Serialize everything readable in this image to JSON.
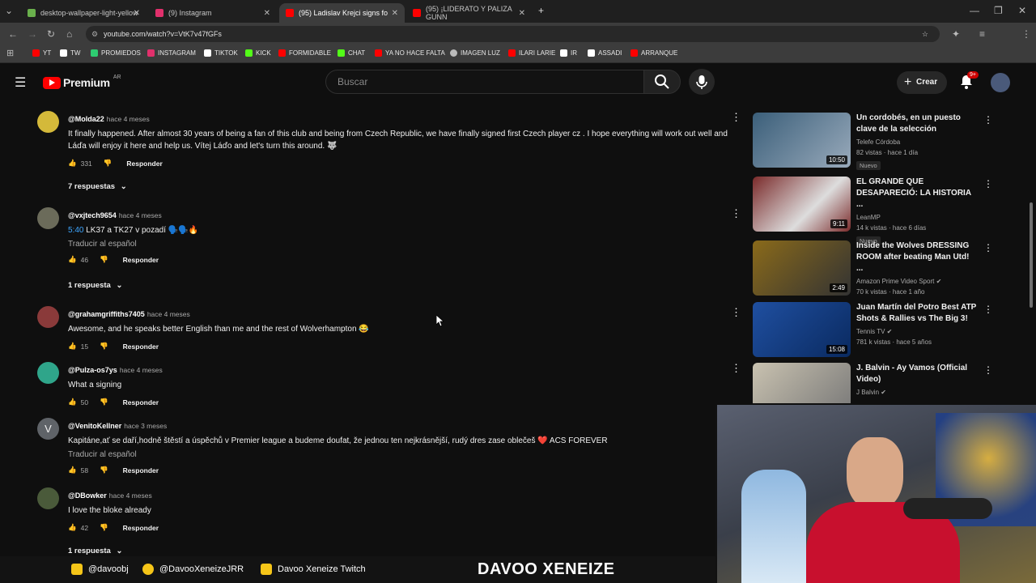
{
  "browser": {
    "tabs": [
      {
        "label": "desktop-wallpaper-light-yellow",
        "color": "#6ab04c"
      },
      {
        "label": "(9) Instagram",
        "color": "#e1306c"
      },
      {
        "label": "(95) Ladislav Krejci signs fo",
        "color": "#ff0000"
      },
      {
        "label": "(95) ¡LIDERATO Y PALIZA GUNN",
        "color": "#ff0000"
      }
    ],
    "url": "youtube.com/watch?v=VtK7v47fGFs",
    "bookmarks": [
      {
        "label": "YT",
        "color": "#ff0000"
      },
      {
        "label": "TW",
        "color": "#ffffff"
      },
      {
        "label": "PROMIEDOS",
        "color": "#2ecc71"
      },
      {
        "label": "INSTAGRAM",
        "color": "#e1306c"
      },
      {
        "label": "TIKTOK",
        "color": "#ffffff"
      },
      {
        "label": "KICK",
        "color": "#53fc18"
      },
      {
        "label": "FORMIDABLE",
        "color": "#ff0000"
      },
      {
        "label": "CHAT",
        "color": "#53fc18"
      },
      {
        "label": "YA NO HACE FALTA",
        "color": "#ff0000"
      },
      {
        "label": "IMAGEN LUZ",
        "color": "#bbbbbb"
      },
      {
        "label": "ILARI LARIE",
        "color": "#ff0000"
      },
      {
        "label": "IR",
        "color": "#ffffff"
      },
      {
        "label": "ASSADI",
        "color": "#ffffff"
      },
      {
        "label": "ARRANQUE",
        "color": "#ff0000"
      }
    ]
  },
  "youtube": {
    "logo": "Premium",
    "region": "AR",
    "search_placeholder": "Buscar",
    "create_label": "Crear",
    "notif_count": "9+"
  },
  "comments": [
    {
      "handle": "@Molda22",
      "ago": "hace 4 meses",
      "text": "It finally happened. After almost 30 years of being a fan of this club and being from Czech Republic, we have finally signed first Czech player cz . I hope everything will work out well and Láďa will enjoy it here and help us. Vítej Láďo and let's turn this around. 🐺",
      "likes": "331",
      "reply": "Responder",
      "avatar_color": "#d4b93a"
    },
    {
      "handle": "@vxjtech9654",
      "ago": "hace 4 meses",
      "timestamp": "5:40",
      "text": "LK37 a TK27 v pozadí 🗣️🗣️🔥",
      "translate": "Traducir al español",
      "likes": "46",
      "reply": "Responder",
      "avatar_color": "#6b6b5a"
    },
    {
      "handle": "@grahamgriffiths7405",
      "ago": "hace 4 meses",
      "text": "Awesome, and he speaks better English than me and the rest of Wolverhampton 😂",
      "likes": "15",
      "reply": "Responder",
      "avatar_color": "#8a3a3a"
    },
    {
      "handle": "@Pulza-os7ys",
      "ago": "hace 4 meses",
      "text": "What a signing",
      "likes": "50",
      "reply": "Responder",
      "avatar_color": "#2fa58a"
    },
    {
      "handle": "@VenitoKellner",
      "ago": "hace 3 meses",
      "text": "Kapitáne,ať se daří,hodně štěstí a úspěchů v Premier league a budeme doufat, že jednou ten nejkrásnější, rudý dres zase oblečeš ❤️ ACS FOREVER",
      "translate": "Traducir al español",
      "likes": "58",
      "reply": "Responder",
      "avatar_color": "#5f6368",
      "avatar_letter": "V"
    },
    {
      "handle": "@DBowker",
      "ago": "hace 4 meses",
      "text": "I love the bloke already",
      "likes": "42",
      "reply": "Responder",
      "avatar_color": "#4a5a3a"
    }
  ],
  "reply_toggles": [
    "7 respuestas",
    "1 respuesta",
    "1 respuesta"
  ],
  "sidebar": [
    {
      "title": "Un cordobés, en un puesto clave de la selección",
      "channel": "Telefe Córdoba",
      "meta": "82 vistas · hace 1 día",
      "badge": "Nuevo",
      "duration": "10:50",
      "thumb": "#3b5f7a"
    },
    {
      "title": "EL GRANDE QUE DESAPARECIÓ: LA HISTORIA ...",
      "channel": "LeanMP",
      "meta": "14 k vistas · hace 6 días",
      "badge": "Nuevo",
      "duration": "9:11",
      "thumb": "#7a2a2a"
    },
    {
      "title": "Inside the Wolves DRESSING ROOM after beating Man Utd! ...",
      "channel": "Amazon Prime Video Sport",
      "meta": "70 k vistas · hace 1 año",
      "duration": "2:49",
      "thumb": "#8a6a1a"
    },
    {
      "title": "Juan Martín del Potro Best ATP Shots & Rallies vs The Big 3!",
      "channel": "Tennis TV",
      "meta": "781 k vistas · hace 5 años",
      "duration": "15:08",
      "thumb": "#1f4fa0"
    },
    {
      "title": "J. Balvin - Ay Vamos (Official Video)",
      "channel": "J Balvin",
      "meta": "",
      "thumb": "#c9c2b0"
    }
  ],
  "stream": {
    "instagram": "@davoobj",
    "twitter": "@DavooXeneizeJRR",
    "twitch": "Davoo Xeneize Twitch",
    "brand": "DAVOO XENEIZE"
  }
}
